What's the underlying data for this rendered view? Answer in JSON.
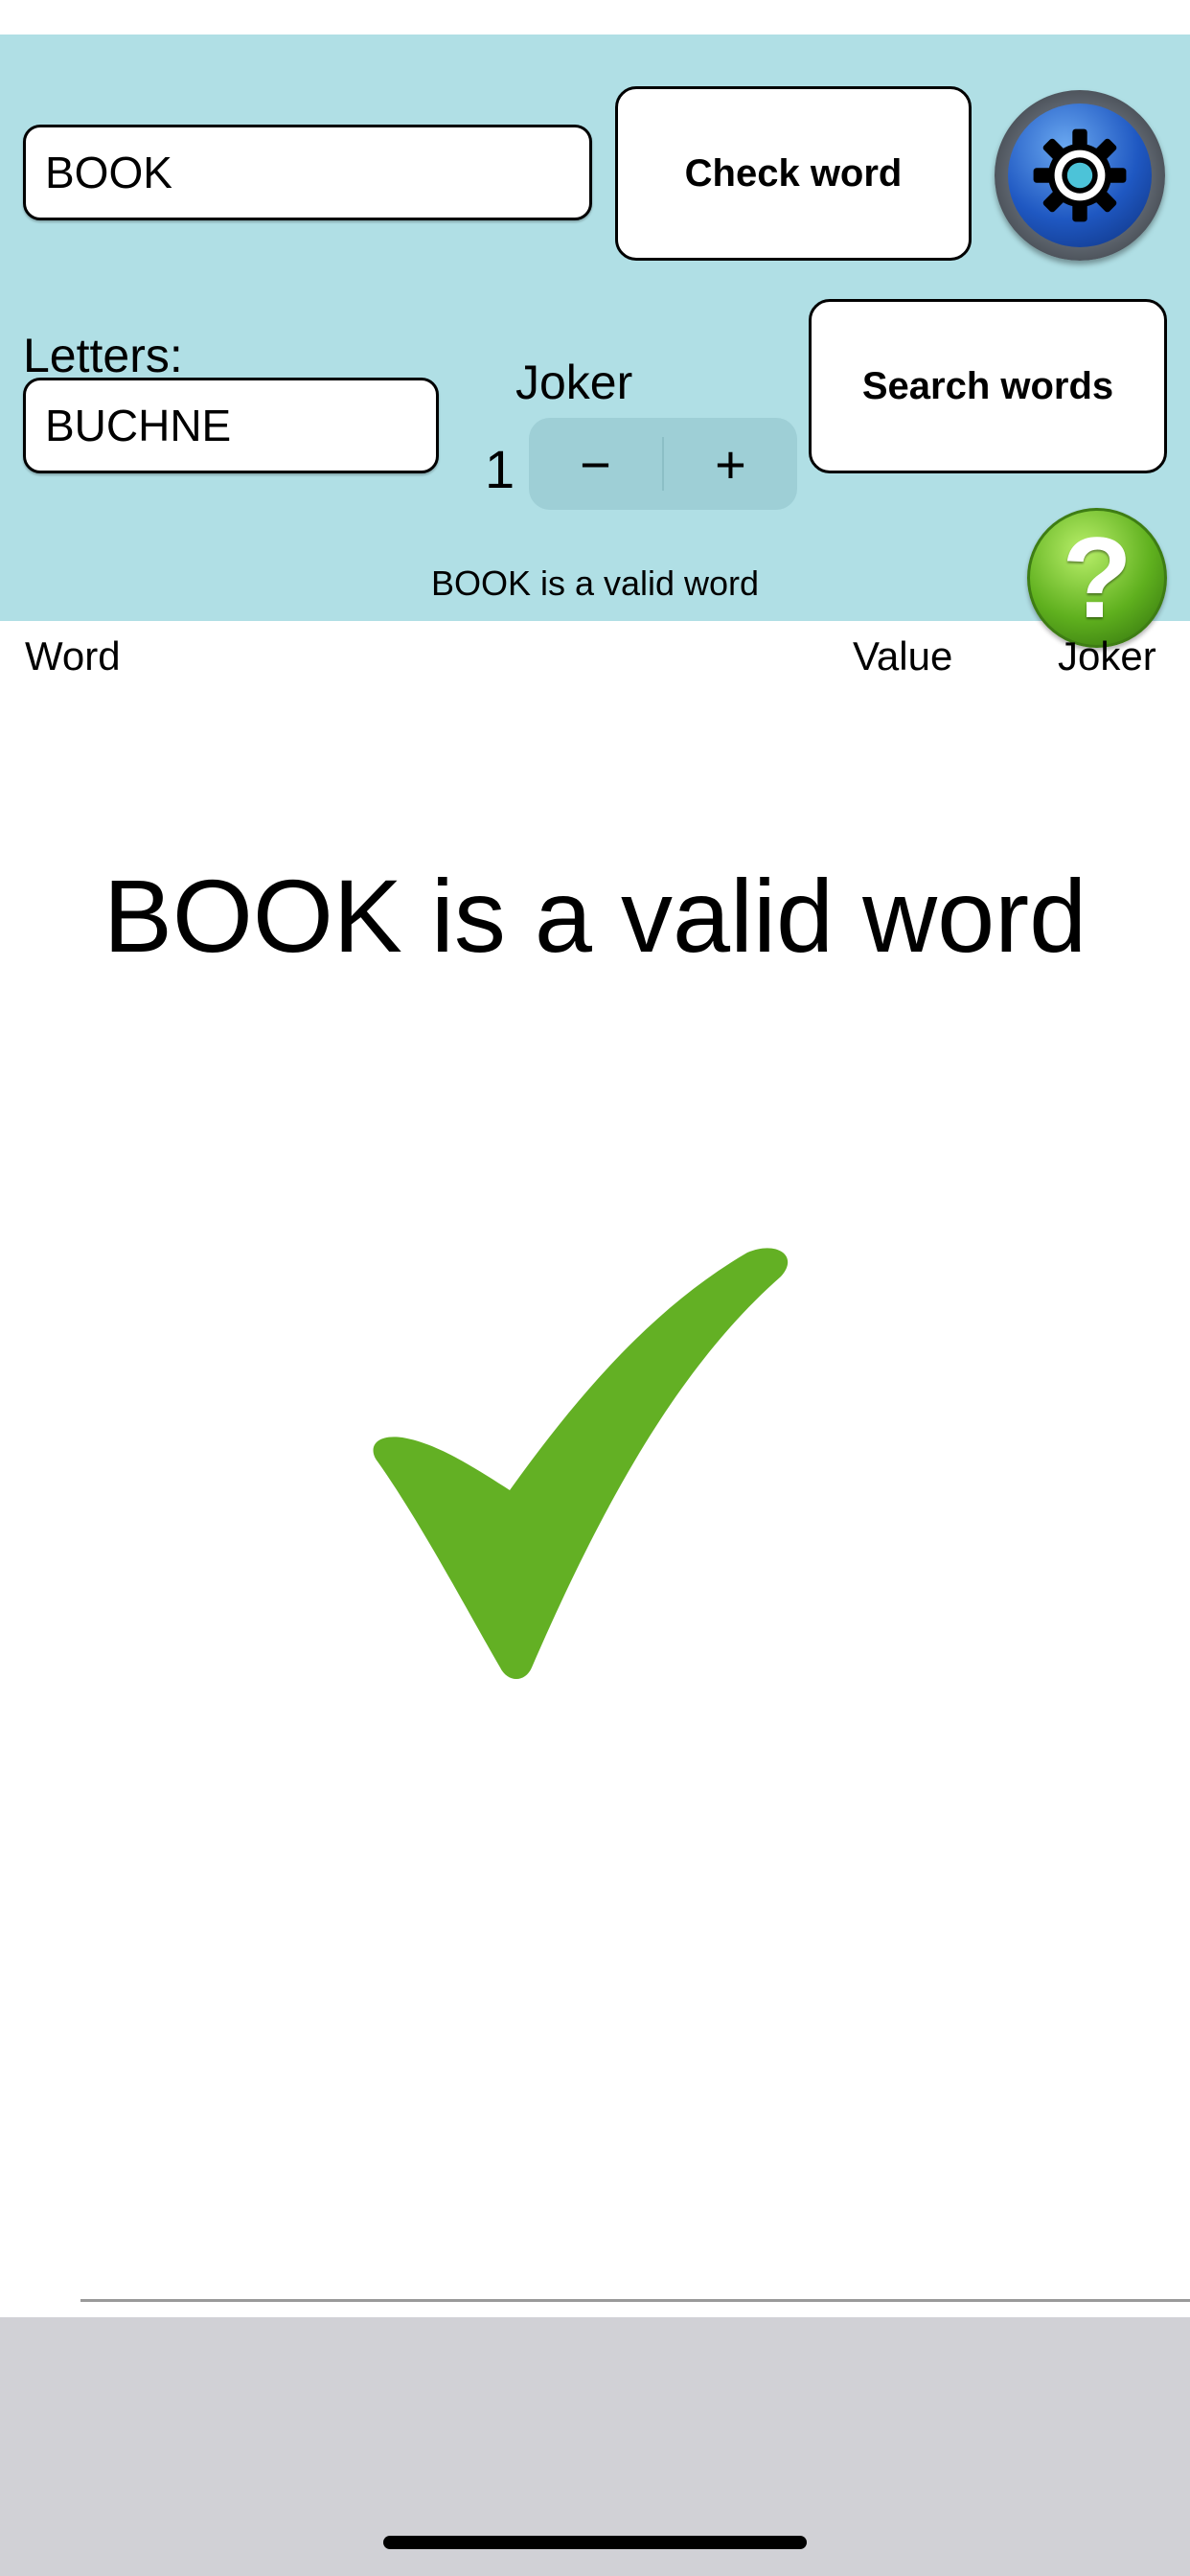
{
  "input": {
    "word_value": "BOOK",
    "letters_value": "BUCHNE"
  },
  "buttons": {
    "check_word": "Check word",
    "search_words": "Search words"
  },
  "labels": {
    "letters": "Letters:",
    "joker": "Joker"
  },
  "joker": {
    "count": "1",
    "minus": "−",
    "plus": "+"
  },
  "status": {
    "message": "BOOK is a valid word"
  },
  "table": {
    "columns": [
      "Word",
      "Value",
      "Joker"
    ]
  },
  "result": {
    "message": "BOOK is a valid word",
    "icon": "checkmark-icon",
    "color": "#63b024"
  },
  "help": {
    "symbol": "?"
  },
  "colors": {
    "panel": "#b0dfe5",
    "bottom_bar": "#d1d1d6"
  }
}
